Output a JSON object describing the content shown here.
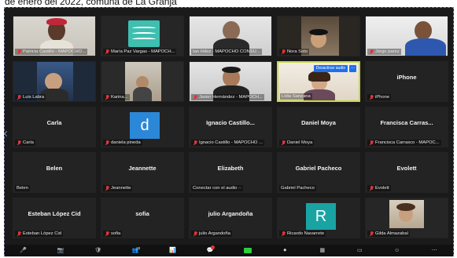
{
  "caption": "de enero del 2022, comuna de La Granja",
  "colors": {
    "accent_green": "#2ecc40",
    "active_border": "#c8d84a",
    "mute_red": "#e0353a",
    "pill_blue": "#1f6feb"
  },
  "tiles": [
    {
      "label": "Patricia Castillo - MAPOCHO...",
      "type": "video",
      "muted": true
    },
    {
      "label": "María Paz Vargas - MAPOCH...",
      "type": "logo",
      "muted": true
    },
    {
      "label": "Ian Hdez - MAPOCHO CONSU...",
      "type": "video",
      "muted": false
    },
    {
      "label": "Nora Soto",
      "type": "video",
      "muted": true
    },
    {
      "label": "Jorge parez",
      "type": "video",
      "muted": true
    },
    {
      "label": "Luis Labra",
      "type": "video",
      "muted": true
    },
    {
      "label": "Karina...",
      "type": "video",
      "muted": true
    },
    {
      "label": "Javier Hernández - MAPOCH...",
      "type": "video",
      "muted": true
    },
    {
      "label": "Lidia Sanzana",
      "type": "video",
      "muted": false,
      "active": true,
      "pill": "Desactivar audio",
      "more": "..."
    },
    {
      "label": "iPhone",
      "center": "iPhone",
      "type": "name",
      "muted": true
    },
    {
      "label": "Carla",
      "center": "Carla",
      "type": "name",
      "muted": true
    },
    {
      "label": "daniela pineda",
      "type": "avatar",
      "avatar_letter": "d",
      "avatar_color": "#2b88d8",
      "muted": true
    },
    {
      "label": "Ignacio Castillo - MAPOCHO ...",
      "center": "Ignacio Castillo...",
      "type": "name",
      "muted": true
    },
    {
      "label": "Daniel Moya",
      "center": "Daniel Moya",
      "type": "name",
      "muted": true
    },
    {
      "label": "Francisca Carrasco - MAPOC...",
      "center": "Francisca Carras...",
      "type": "name",
      "muted": true
    },
    {
      "label": "Belen",
      "center": "Belen",
      "type": "name",
      "muted": false
    },
    {
      "label": "Jeannette",
      "center": "Jeannette",
      "type": "name",
      "muted": true
    },
    {
      "label": "Conectar con el audio ··",
      "center": "Elizabeth",
      "type": "name",
      "muted": false
    },
    {
      "label": "Gabriel Pacheco",
      "center": "Gabriel Pacheco",
      "type": "name",
      "muted": false
    },
    {
      "label": "Evolett",
      "center": "Evolett",
      "type": "name",
      "muted": true
    },
    {
      "label": "Esteban López Cid",
      "center": "Esteban López Cid",
      "type": "name",
      "muted": true
    },
    {
      "label": "sofia",
      "center": "sofia",
      "type": "name",
      "muted": true
    },
    {
      "label": "julio Argandoña",
      "center": "julio Argandoña",
      "type": "name",
      "muted": true
    },
    {
      "label": "Ricardo Navarrete",
      "type": "avatar",
      "avatar_letter": "R",
      "avatar_color": "#1aa3a3",
      "muted": true
    },
    {
      "label": "Gilda Almazabal",
      "type": "video",
      "muted": true
    }
  ],
  "toolbar": {
    "participants_count": "28",
    "chat_badge": "9"
  }
}
